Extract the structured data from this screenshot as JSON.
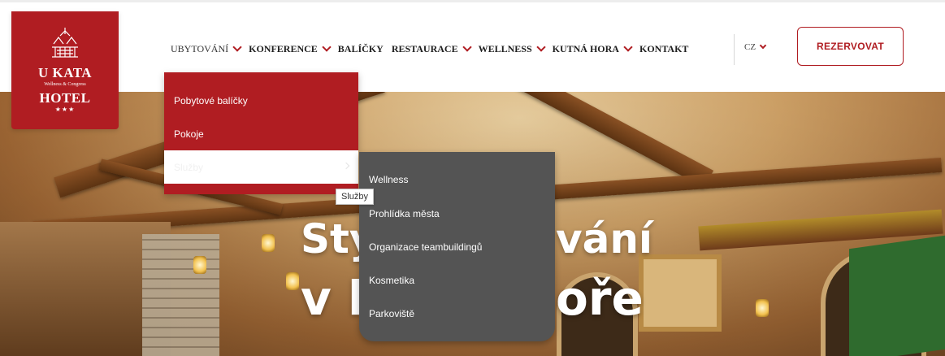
{
  "logo": {
    "title_line1": "U KATA",
    "subtitle": "Wellness & Congress",
    "title_line2": "HOTEL",
    "stars": "★★★",
    "brand_color": "#b01d22"
  },
  "nav": {
    "items": [
      {
        "label": "UBYTOVÁNÍ",
        "has_dropdown": true,
        "active": true
      },
      {
        "label": "KONFERENCE",
        "has_dropdown": true
      },
      {
        "label": "BALÍČKY",
        "has_dropdown": false
      },
      {
        "label": "RESTAURACE",
        "has_dropdown": true
      },
      {
        "label": "WELLNESS",
        "has_dropdown": true
      },
      {
        "label": "KUTNÁ HORA",
        "has_dropdown": true
      },
      {
        "label": "KONTAKT",
        "has_dropdown": false
      }
    ],
    "language": "CZ",
    "reserve_label": "REZERVOVAT"
  },
  "dropdown": {
    "items": [
      {
        "label": "Pobytové balíčky"
      },
      {
        "label": "Pokoje"
      },
      {
        "label": "Služby",
        "hovered": true
      }
    ]
  },
  "submenu": {
    "items": [
      {
        "label": "Wellness"
      },
      {
        "label": "Prohlídka města"
      },
      {
        "label": "Organizace teambuildingů"
      },
      {
        "label": "Kosmetika"
      },
      {
        "label": "Parkoviště"
      }
    ]
  },
  "tooltip": {
    "text": "Služby"
  },
  "hero": {
    "line1_left": "Sty",
    "line1_right": "vání",
    "line2_left": "v k",
    "line2_right": "oře"
  }
}
